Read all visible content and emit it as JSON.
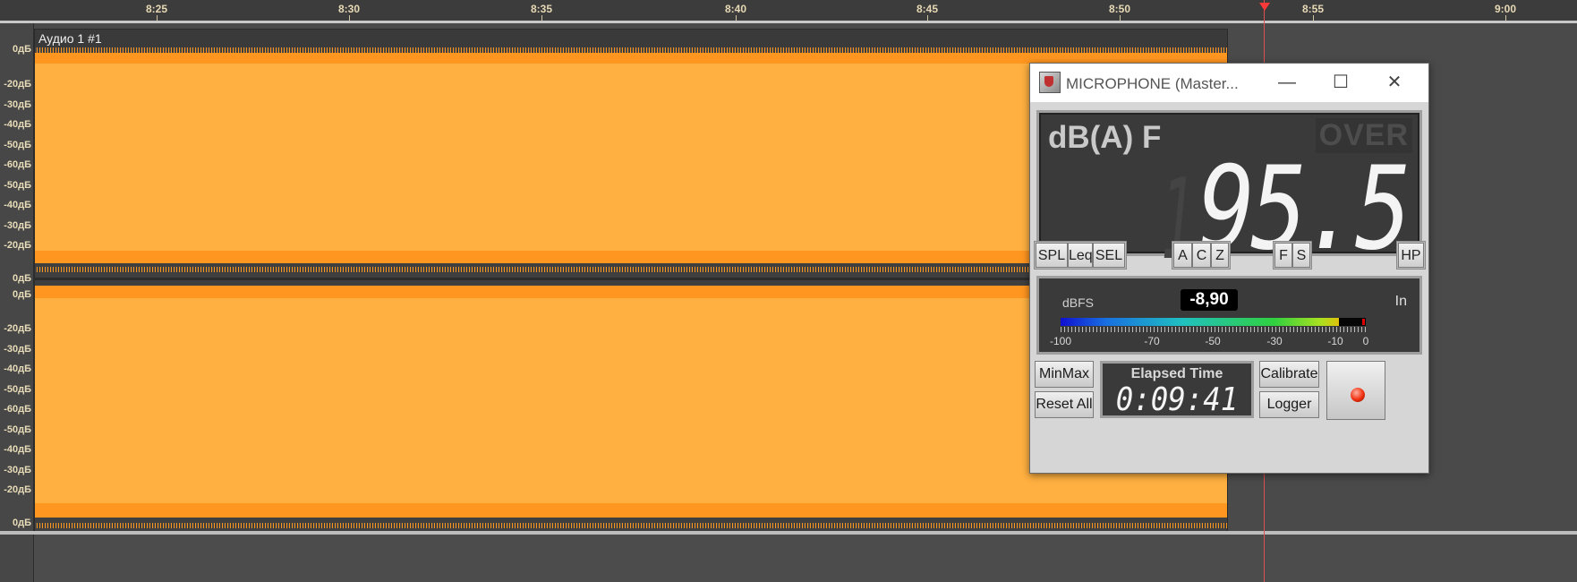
{
  "ruler": {
    "ticks": [
      {
        "label": "8:25"
      },
      {
        "label": "8:30"
      },
      {
        "label": "8:35"
      },
      {
        "label": "8:40"
      },
      {
        "label": "8:45"
      },
      {
        "label": "8:50"
      },
      {
        "label": "8:55"
      },
      {
        "label": "9:00"
      }
    ]
  },
  "track": {
    "clip_title": "Аудио 1 #1",
    "db_labels": [
      "0дБ",
      "-20дБ",
      "-30дБ",
      "-40дБ",
      "-50дБ",
      "-60дБ",
      "-50дБ",
      "-40дБ",
      "-30дБ",
      "-20дБ",
      "0дБ"
    ]
  },
  "meter": {
    "window_title": "MICROPHONE (Master...",
    "weighting_label": "dB(A) F",
    "over_label": "OVER",
    "reading": "95.5",
    "ghost_digit": "1",
    "buttons_mode": [
      "SPL",
      "Leq",
      "SEL"
    ],
    "buttons_weighting": [
      "A",
      "C",
      "Z"
    ],
    "buttons_time": [
      "F",
      "S"
    ],
    "hp_label": "HP",
    "dbfs_label": "dBFS",
    "dbfs_value": "-8,90",
    "input_label": "In",
    "level_fraction": 0.911,
    "scale_labels": [
      "-100",
      "-70",
      "-50",
      "-30",
      "-10",
      "0"
    ],
    "minmax_label": "MinMax",
    "reset_label": "Reset All",
    "elapsed_label": "Elapsed Time",
    "elapsed_value": "0:09:41",
    "calibrate_label": "Calibrate",
    "logger_label": "Logger"
  },
  "colors": {
    "wave_outer": "#ff9620",
    "wave_inner": "#ffb040",
    "playhead": "#e05050"
  },
  "icons": {
    "app": "microphone-app-icon",
    "minimize": "minimize-icon",
    "maximize": "maximize-icon",
    "close": "close-icon",
    "record": "record-led-icon"
  }
}
